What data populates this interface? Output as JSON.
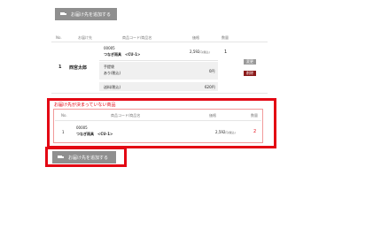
{
  "add_delivery_button": {
    "label": "お届け先を追加する"
  },
  "delivery_table": {
    "headers": {
      "no": "No.",
      "destination": "お届け先",
      "product": "商品コード/商品名",
      "price": "価格",
      "qty": "数量"
    },
    "row": {
      "no": "1",
      "recipient": "西宮太郎",
      "item": {
        "code": "00005",
        "name": "つなぎ雨具　<CU-1>",
        "price": "2,592",
        "price_suffix": "円(税込)",
        "qty": "1"
      },
      "wrapping": {
        "line1": "手提袋",
        "line2": "あり(税込)",
        "price": "0円"
      },
      "shipping": {
        "label": "送料(税込)",
        "price": "620円"
      },
      "change_label": "変更",
      "delete_label": "削除"
    }
  },
  "unassigned": {
    "title": "お届け先が決まっていない商品",
    "headers": {
      "no": "No.",
      "product": "商品コード/商品名",
      "price": "価格",
      "qty": "数量"
    },
    "row": {
      "no": "1",
      "code": "00005",
      "name": "つなぎ雨具　<CU-1>",
      "price": "2,592",
      "price_suffix": "円(税込)",
      "qty": "2"
    }
  },
  "colors": {
    "highlight": "#e30613",
    "button_gray": "#8f8f8f",
    "delete": "#8b1a1a"
  }
}
